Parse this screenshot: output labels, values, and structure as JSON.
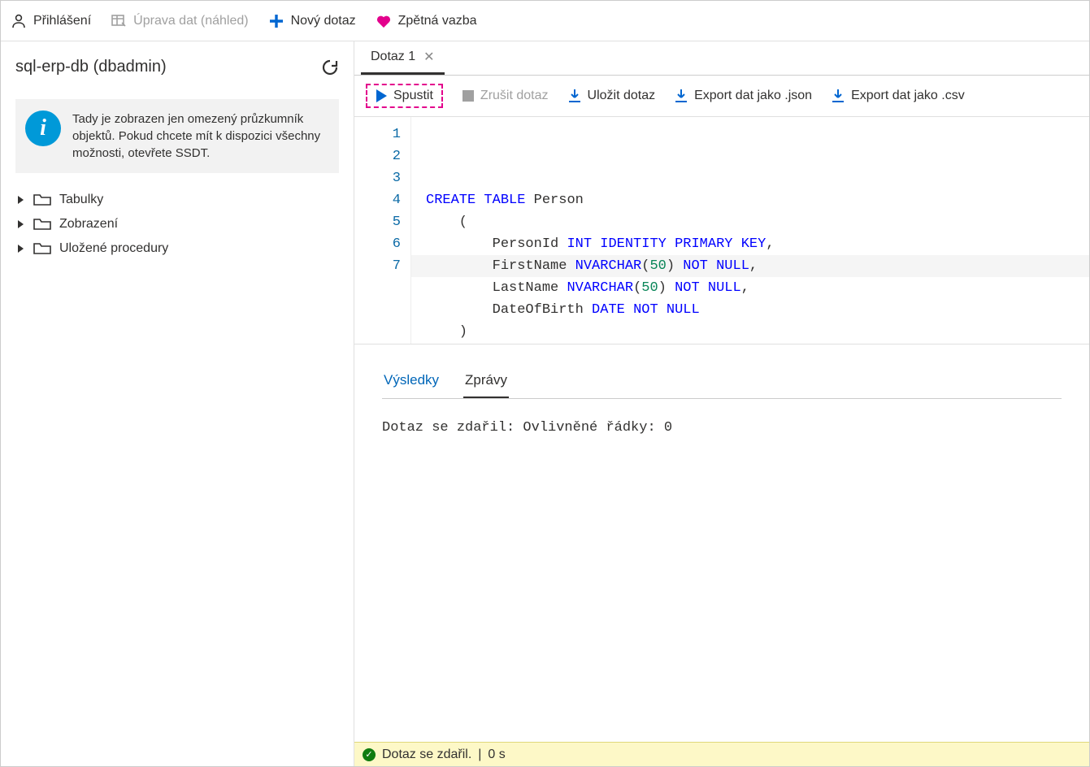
{
  "topbar": {
    "login": "Přihlášení",
    "edit_data": "Úprava dat (náhled)",
    "new_query": "Nový dotaz",
    "feedback": "Zpětná vazba"
  },
  "sidebar": {
    "db_title": "sql-erp-db (dbadmin)",
    "info_text": "Tady je zobrazen jen omezený průzkumník objektů. Pokud chcete mít k dispozici všechny možnosti, otevřete SSDT.",
    "tree": {
      "tables": "Tabulky",
      "views": "Zobrazení",
      "sprocs": "Uložené procedury"
    }
  },
  "tabs": {
    "q1": "Dotaz 1"
  },
  "toolbar": {
    "run": "Spustit",
    "cancel": "Zrušit dotaz",
    "save": "Uložit dotaz",
    "export_json": "Export dat jako .json",
    "export_csv": "Export dat jako .csv"
  },
  "editor": {
    "line_numbers": [
      "1",
      "2",
      "3",
      "4",
      "5",
      "6",
      "7"
    ],
    "code_tokens": [
      [
        {
          "t": "CREATE",
          "c": "kw"
        },
        {
          "t": " "
        },
        {
          "t": "TABLE",
          "c": "kw"
        },
        {
          "t": " Person"
        }
      ],
      [
        {
          "t": "    ("
        }
      ],
      [
        {
          "t": "        PersonId "
        },
        {
          "t": "INT",
          "c": "kw"
        },
        {
          "t": " "
        },
        {
          "t": "IDENTITY",
          "c": "kw"
        },
        {
          "t": " "
        },
        {
          "t": "PRIMARY",
          "c": "kw"
        },
        {
          "t": " "
        },
        {
          "t": "KEY",
          "c": "kw"
        },
        {
          "t": ","
        }
      ],
      [
        {
          "t": "        FirstName "
        },
        {
          "t": "NVARCHAR",
          "c": "kw"
        },
        {
          "t": "("
        },
        {
          "t": "50",
          "c": "num"
        },
        {
          "t": ") "
        },
        {
          "t": "NOT",
          "c": "kw"
        },
        {
          "t": " "
        },
        {
          "t": "NULL",
          "c": "kw"
        },
        {
          "t": ","
        }
      ],
      [
        {
          "t": "        LastName "
        },
        {
          "t": "NVARCHAR",
          "c": "kw"
        },
        {
          "t": "("
        },
        {
          "t": "50",
          "c": "num"
        },
        {
          "t": ") "
        },
        {
          "t": "NOT",
          "c": "kw"
        },
        {
          "t": " "
        },
        {
          "t": "NULL",
          "c": "kw"
        },
        {
          "t": ","
        }
      ],
      [
        {
          "t": "        DateOfBirth "
        },
        {
          "t": "DATE",
          "c": "kw"
        },
        {
          "t": " "
        },
        {
          "t": "NOT",
          "c": "kw"
        },
        {
          "t": " "
        },
        {
          "t": "NULL",
          "c": "kw"
        }
      ],
      [
        {
          "t": "    )"
        }
      ]
    ]
  },
  "results": {
    "tab_results": "Výsledky",
    "tab_messages": "Zprávy",
    "message": "Dotaz se zdařil: Ovlivněné řádky: 0"
  },
  "status": {
    "text": "Dotaz se zdařil.",
    "time": "0 s"
  }
}
